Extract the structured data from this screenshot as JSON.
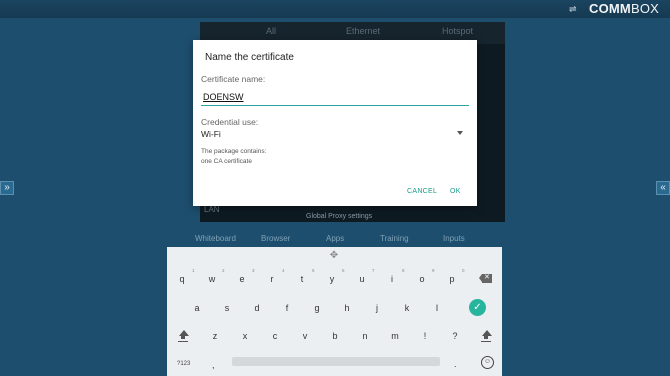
{
  "topbar": {
    "brand_bold": "COMM",
    "brand_light": "BOX",
    "usb_icon": "usb-icon"
  },
  "bg_panel": {
    "tabs": [
      "All",
      "Ethernet",
      "Hotspot"
    ],
    "lan_label": "LAN",
    "proxy_label": "Global Proxy settings"
  },
  "dock": [
    "Whiteboard",
    "Browser",
    "Apps",
    "Training",
    "Inputs"
  ],
  "dialog": {
    "title": "Name the certificate",
    "name_label": "Certificate name:",
    "name_value": "DOENSW",
    "use_label": "Credential use:",
    "use_value": "Wi-Fi",
    "info_line1": "The package contains:",
    "info_line2": "one CA certificate",
    "cancel": "CANCEL",
    "ok": "OK"
  },
  "keyboard": {
    "row1": [
      "q",
      "w",
      "e",
      "r",
      "t",
      "y",
      "u",
      "i",
      "o",
      "p"
    ],
    "row1_hints": [
      "1",
      "2",
      "3",
      "4",
      "5",
      "6",
      "7",
      "8",
      "9",
      "0"
    ],
    "row2": [
      "a",
      "s",
      "d",
      "f",
      "g",
      "h",
      "j",
      "k",
      "l"
    ],
    "row3": [
      "z",
      "x",
      "c",
      "v",
      "b",
      "n",
      "m",
      "!",
      "?"
    ],
    "num_label": "?123",
    "comma": ",",
    "period": "."
  },
  "colors": {
    "accent": "#27b59e",
    "background": "#1d4e6e"
  }
}
